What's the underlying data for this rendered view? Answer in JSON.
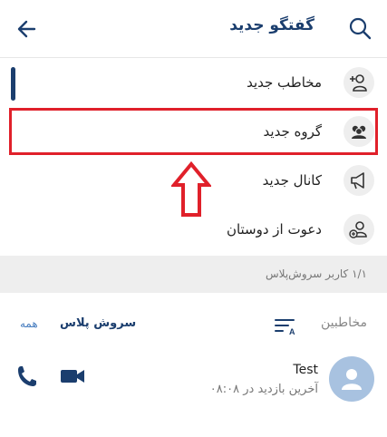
{
  "header": {
    "title": "گفتگو جدید",
    "back_icon": "arrow-left-icon",
    "search_icon": "search-icon"
  },
  "menu": {
    "items": [
      {
        "label": "مخاطب جدید",
        "icon": "add-contact-icon"
      },
      {
        "label": "گروه جدید",
        "icon": "group-icon"
      },
      {
        "label": "کانال جدید",
        "icon": "megaphone-icon"
      },
      {
        "label": "دعوت از دوستان",
        "icon": "invite-friend-icon"
      }
    ]
  },
  "section": {
    "text": "۱/۱ کاربر سروش‌پلاس"
  },
  "contacts": {
    "title": "مخاطبین",
    "sort_icon": "sort-icon",
    "filter_selected": "سروش پلاس",
    "filter_all": "همه",
    "list": [
      {
        "name": "Test",
        "status": "آخرین بازدید در ۰۸:۰۸"
      }
    ]
  },
  "colors": {
    "accent": "#1b3e6e",
    "highlight": "#e0202a",
    "avatar": "#a8c2e0",
    "section_bg": "#eeeeee"
  }
}
